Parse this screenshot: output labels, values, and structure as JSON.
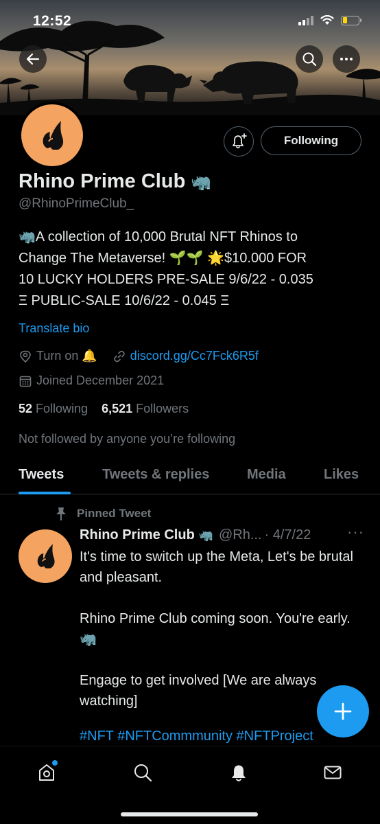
{
  "status_bar": {
    "time": "12:52",
    "icons": [
      "signal-icon",
      "wifi-icon",
      "battery-icon"
    ]
  },
  "header": {
    "back_icon": "arrow-left-icon",
    "search_icon": "search-icon",
    "more_icon": "more-horizontal-icon"
  },
  "profile": {
    "display_name": "Rhino Prime Club",
    "name_emoji": "🦏",
    "handle": "@RhinoPrimeClub_",
    "bio_lines": [
      "🦏A collection of 10,000 Brutal NFT Rhinos to",
      "Change The Metaverse! 🌱🌱 🌟$10.000 FOR",
      "10 LUCKY HOLDERS PRE-SALE 9/6/22 - 0.035",
      "Ξ PUBLIC-SALE 10/6/22 - 0.045 Ξ"
    ],
    "translate_label": "Translate bio",
    "location": "Turn on 🔔",
    "website": "discord.gg/Cc7Fck6R5f",
    "joined": "Joined December 2021",
    "following_count": "52",
    "following_label": "Following",
    "followers_count": "6,521",
    "followers_label": "Followers",
    "not_followed": "Not followed by anyone you’re following"
  },
  "actions": {
    "following_button": "Following",
    "notify_icon": "bell-plus-icon"
  },
  "tabs": [
    {
      "label": "Tweets",
      "active": true
    },
    {
      "label": "Tweets & replies",
      "active": false
    },
    {
      "label": "Media",
      "active": false
    },
    {
      "label": "Likes",
      "active": false
    }
  ],
  "tweet": {
    "pinned_label": "Pinned Tweet",
    "author": "Rhino Prime Club",
    "author_emoji": "🦏",
    "handle": "@Rh...",
    "date": "· 4/7/22",
    "more": "···",
    "paragraphs": [
      "It's time to switch up the Meta, Let's be brutal and pleasant.",
      "Rhino Prime Club coming soon. You're early. 🦏",
      "Engage to get involved [We are always watching]"
    ],
    "hashtags": "#NFT #NFTCommmunity #NFTProject"
  },
  "fab": {
    "icon": "plus-icon"
  },
  "bottom_nav": [
    "home-icon",
    "search-icon",
    "notifications-icon",
    "messages-icon"
  ],
  "colors": {
    "accent": "#1d9bf0",
    "avatar_bg": "#f4a460",
    "muted": "#71767b",
    "text": "#e7e9ea"
  }
}
